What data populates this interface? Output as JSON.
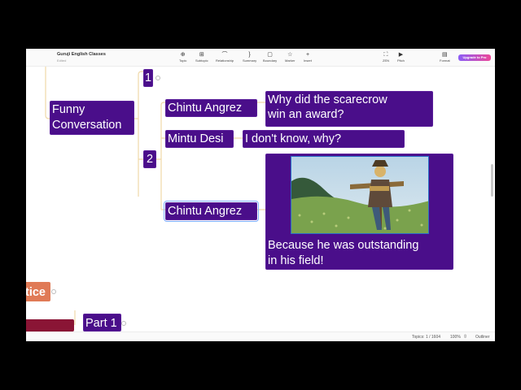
{
  "document": {
    "title": "Guruji English Classes",
    "status": "Edited"
  },
  "toolbar": {
    "tools": [
      {
        "label": "Topic",
        "icon": "topic-icon",
        "glyph": "⊕"
      },
      {
        "label": "Subtopic",
        "icon": "subtopic-icon",
        "glyph": "⊞"
      },
      {
        "label": "Relationship",
        "icon": "relationship-icon",
        "glyph": "⌒"
      },
      {
        "label": "Summary",
        "icon": "summary-icon",
        "glyph": "}"
      },
      {
        "label": "Boundary",
        "icon": "boundary-icon",
        "glyph": "▢"
      },
      {
        "label": "Marker",
        "icon": "marker-icon",
        "glyph": "☆"
      },
      {
        "label": "Insert",
        "icon": "insert-icon",
        "glyph": "+"
      },
      {
        "label": "ZEN",
        "icon": "zen-icon",
        "glyph": "⛶"
      },
      {
        "label": "Pitch",
        "icon": "pitch-icon",
        "glyph": "▶"
      },
      {
        "label": "Format",
        "icon": "format-icon",
        "glyph": "▤"
      }
    ],
    "upgrade_label": "Upgrade to Pro"
  },
  "map": {
    "central": "Funny\nConversation",
    "branch_1": "1",
    "branch_2": "2",
    "speaker_a1": "Chintu Angrez",
    "line_a1": "Why did the scarecrow\nwin an award?",
    "speaker_b": "Mintu Desi",
    "line_b": "I don't know, why?",
    "speaker_a2": "Chintu Angrez",
    "line_a2": "Because he was outstanding\nin his field!",
    "partial_orange": "tice",
    "partial_part": "Part 1"
  },
  "image": {
    "subject": "scarecrow-in-field"
  },
  "status": {
    "topics": "Topics: 1 / 1604",
    "zoom": "100%",
    "outliner": "Outliner"
  },
  "colors": {
    "node": "#4a0e8a",
    "orange": "#e07a56",
    "maroon": "#8a1535",
    "branch_line": "#f0d8a8"
  }
}
